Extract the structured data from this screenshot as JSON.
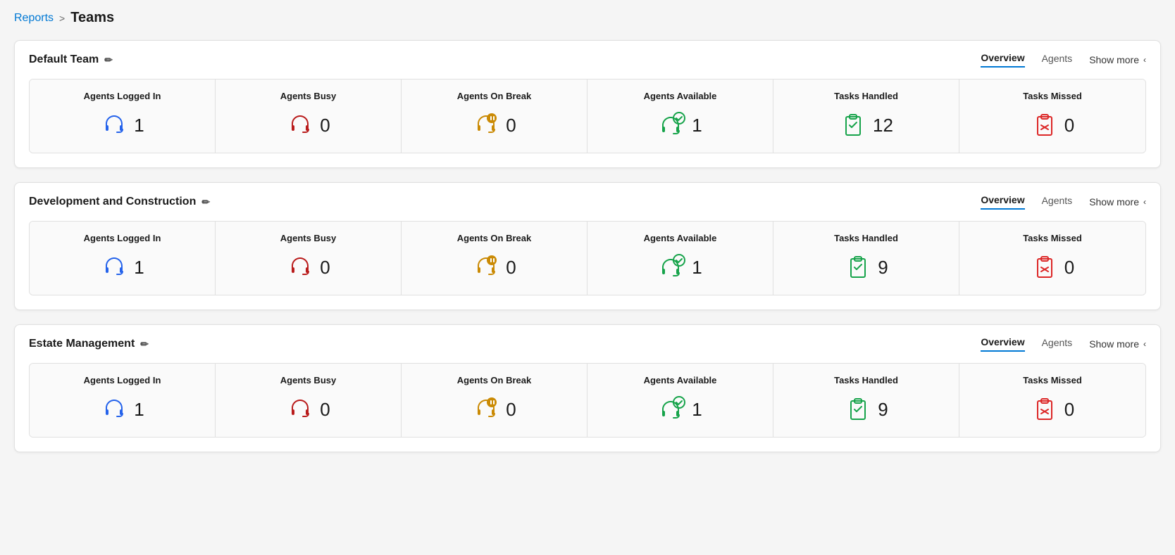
{
  "breadcrumb": {
    "reports_label": "Reports",
    "separator": ">",
    "current_label": "Teams"
  },
  "teams": [
    {
      "name": "Default Team",
      "tabs": [
        "Overview",
        "Agents"
      ],
      "active_tab": "Overview",
      "show_more_label": "Show more",
      "metrics": [
        {
          "label": "Agents Logged In",
          "value": "1",
          "icon": "headset-blue"
        },
        {
          "label": "Agents Busy",
          "value": "0",
          "icon": "headset-red"
        },
        {
          "label": "Agents On Break",
          "value": "0",
          "icon": "headset-yellow-pause"
        },
        {
          "label": "Agents Available",
          "value": "1",
          "icon": "headset-green-check"
        },
        {
          "label": "Tasks Handled",
          "value": "12",
          "icon": "clipboard-check-green"
        },
        {
          "label": "Tasks Missed",
          "value": "0",
          "icon": "clipboard-x-red"
        }
      ]
    },
    {
      "name": "Development and Construction",
      "tabs": [
        "Overview",
        "Agents"
      ],
      "active_tab": "Overview",
      "show_more_label": "Show more",
      "metrics": [
        {
          "label": "Agents Logged In",
          "value": "1",
          "icon": "headset-blue"
        },
        {
          "label": "Agents Busy",
          "value": "0",
          "icon": "headset-red"
        },
        {
          "label": "Agents On Break",
          "value": "0",
          "icon": "headset-yellow-pause"
        },
        {
          "label": "Agents Available",
          "value": "1",
          "icon": "headset-green-check"
        },
        {
          "label": "Tasks Handled",
          "value": "9",
          "icon": "clipboard-check-green"
        },
        {
          "label": "Tasks Missed",
          "value": "0",
          "icon": "clipboard-x-red"
        }
      ]
    },
    {
      "name": "Estate Management",
      "tabs": [
        "Overview",
        "Agents"
      ],
      "active_tab": "Overview",
      "show_more_label": "Show more",
      "metrics": [
        {
          "label": "Agents Logged In",
          "value": "1",
          "icon": "headset-blue"
        },
        {
          "label": "Agents Busy",
          "value": "0",
          "icon": "headset-red"
        },
        {
          "label": "Agents On Break",
          "value": "0",
          "icon": "headset-yellow-pause"
        },
        {
          "label": "Agents Available",
          "value": "1",
          "icon": "headset-green-check"
        },
        {
          "label": "Tasks Handled",
          "value": "9",
          "icon": "clipboard-check-green"
        },
        {
          "label": "Tasks Missed",
          "value": "0",
          "icon": "clipboard-x-red"
        }
      ]
    }
  ]
}
